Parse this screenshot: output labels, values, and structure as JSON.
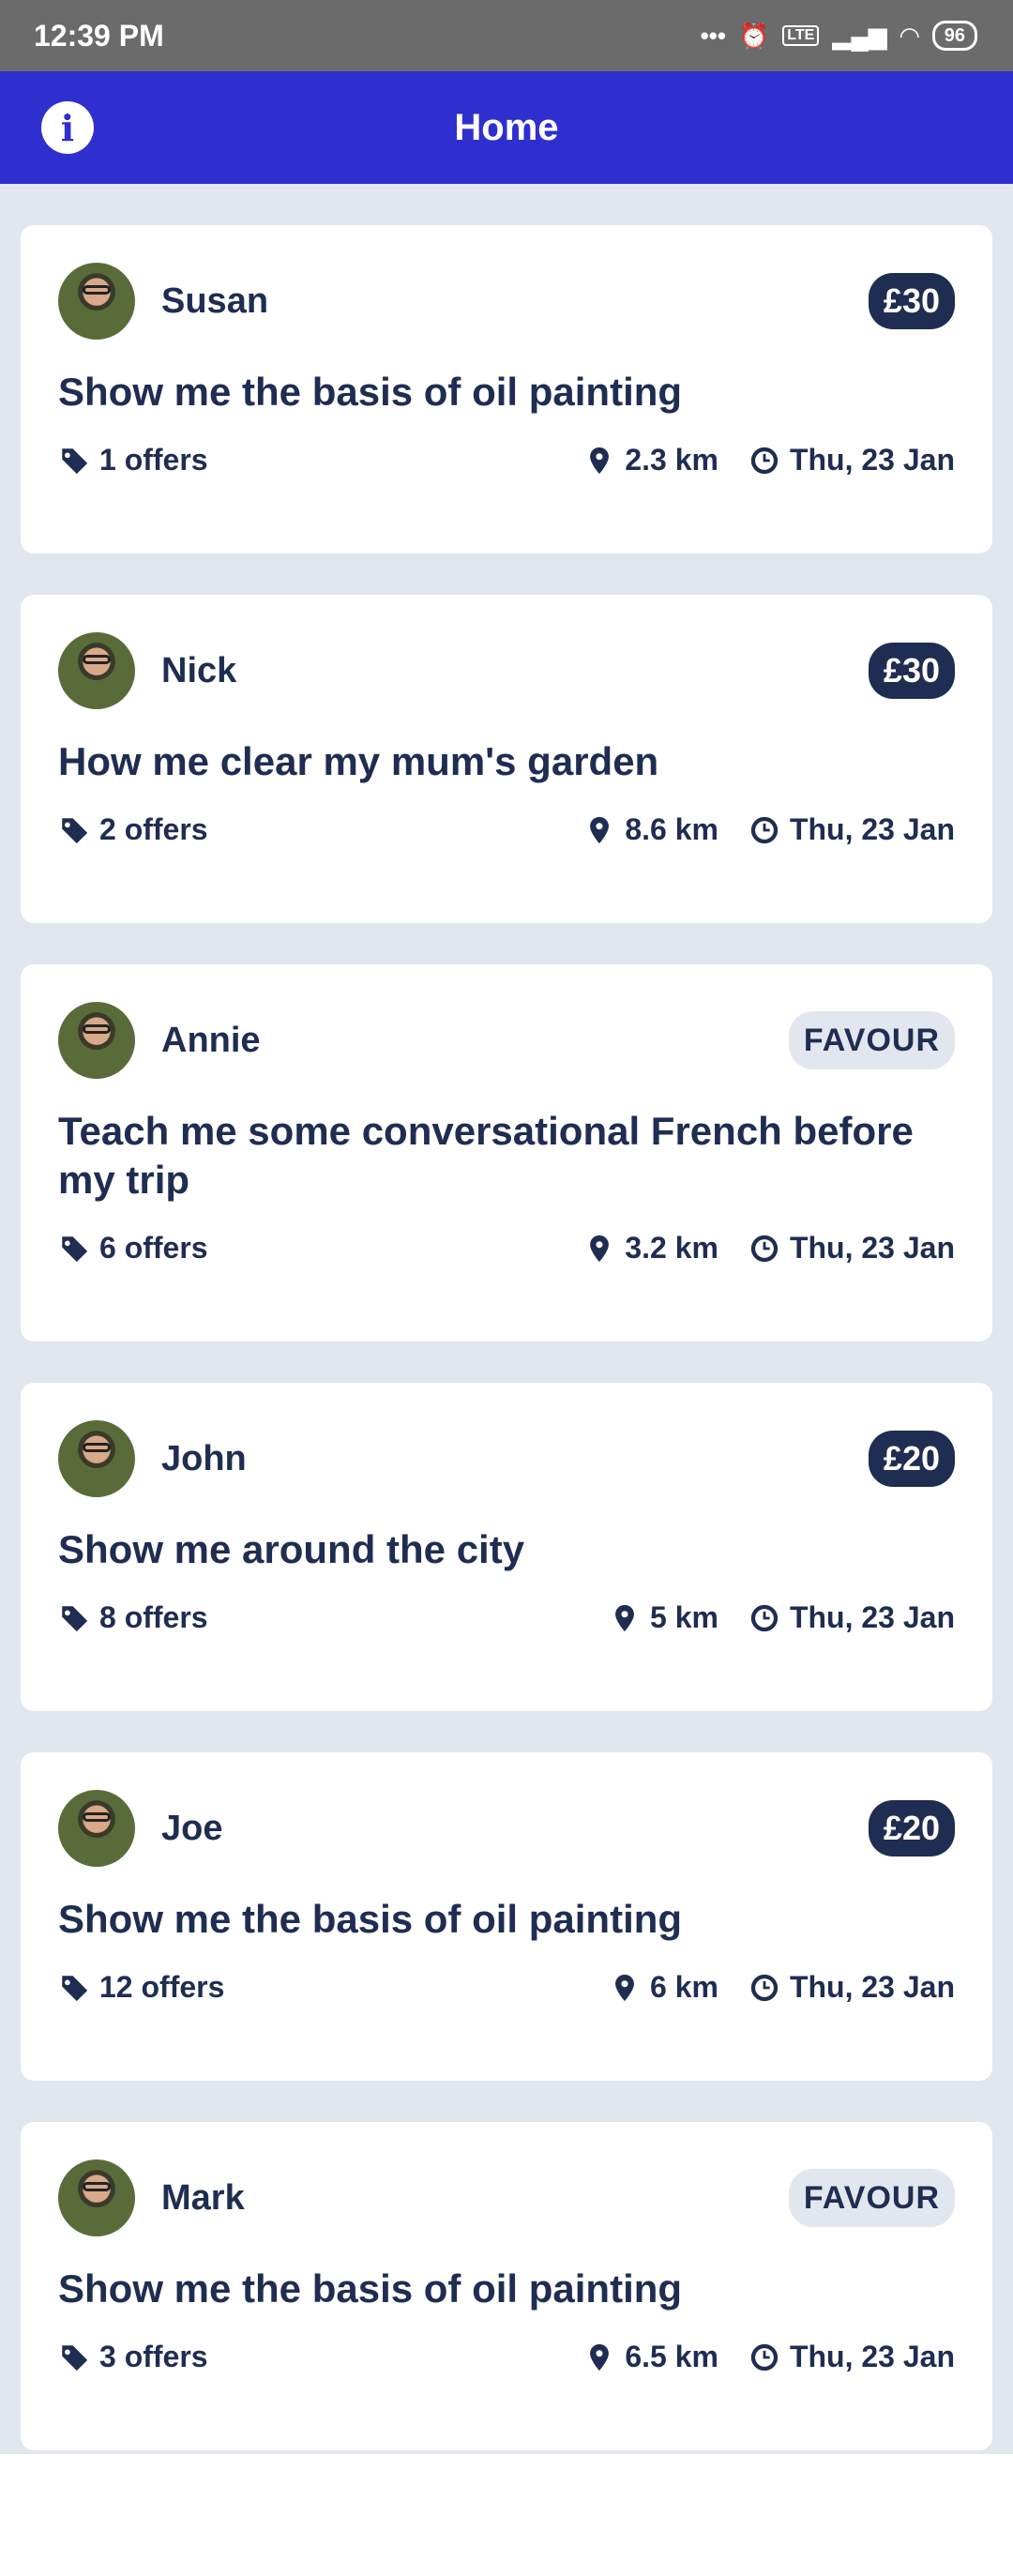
{
  "status_bar": {
    "time": "12:39 PM",
    "battery": "96",
    "network": "LTE"
  },
  "app_bar": {
    "title": "Home",
    "info_icon": "info-icon"
  },
  "cards": [
    {
      "user": "Susan",
      "badge": "£30",
      "badge_type": "price",
      "title": "Show me the basis of oil painting",
      "offers": "1 offers",
      "distance": "2.3 km",
      "date": "Thu, 23 Jan"
    },
    {
      "user": "Nick",
      "badge": "£30",
      "badge_type": "price",
      "title": "How me clear my mum's garden",
      "offers": "2 offers",
      "distance": "8.6 km",
      "date": "Thu, 23 Jan"
    },
    {
      "user": "Annie",
      "badge": "FAVOUR",
      "badge_type": "favour",
      "title": "Teach me some conversational French before my trip",
      "offers": "6 offers",
      "distance": "3.2 km",
      "date": "Thu, 23 Jan"
    },
    {
      "user": "John",
      "badge": "£20",
      "badge_type": "price",
      "title": "Show me around the city",
      "offers": "8 offers",
      "distance": "5 km",
      "date": "Thu, 23 Jan"
    },
    {
      "user": "Joe",
      "badge": "£20",
      "badge_type": "price",
      "title": "Show me the basis of oil painting",
      "offers": "12 offers",
      "distance": "6 km",
      "date": "Thu, 23 Jan"
    },
    {
      "user": "Mark",
      "badge": "FAVOUR",
      "badge_type": "favour",
      "title": "Show me the basis of oil painting",
      "offers": "3 offers",
      "distance": "6.5 km",
      "date": "Thu, 23 Jan"
    }
  ],
  "colors": {
    "app_bar": "#2f2fcf",
    "status_bar": "#6b6b6b",
    "text": "#1f2d52",
    "background": "#e2e6ee"
  }
}
